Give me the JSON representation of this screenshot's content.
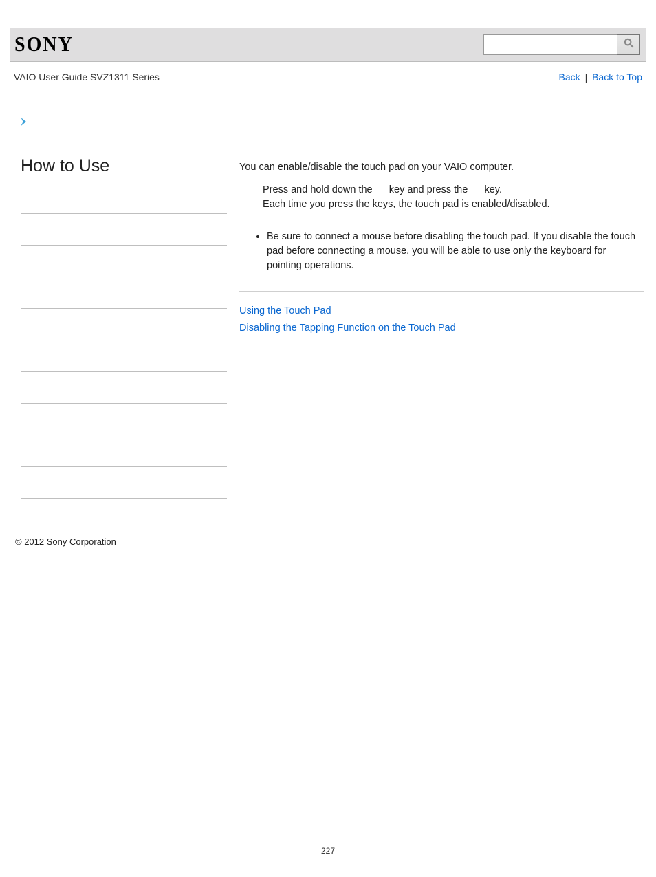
{
  "header": {
    "logo_text": "SONY"
  },
  "search": {
    "value": "",
    "placeholder": ""
  },
  "subheader": {
    "breadcrumb": "VAIO User Guide SVZ1311 Series",
    "back_label": "Back",
    "separator": "|",
    "back_to_top_label": "Back to Top"
  },
  "sidebar": {
    "title": "How to Use",
    "items": [
      "",
      "",
      "",
      "",
      "",
      "",
      "",
      "",
      "",
      ""
    ]
  },
  "main": {
    "intro": "You can enable/disable the touch pad on your VAIO computer.",
    "step_line1_a": "Press and hold down the ",
    "step_line1_b": " key and press the ",
    "step_line1_c": " key.",
    "step_line2": "Each time you press the keys, the touch pad is enabled/disabled.",
    "note_bullet": "Be sure to connect a mouse before disabling the touch pad. If you disable the touch pad before connecting a mouse, you will be able to use only the keyboard for pointing operations.",
    "related_links": [
      "Using the Touch Pad",
      "Disabling the Tapping Function on the Touch Pad"
    ]
  },
  "footer": {
    "copyright": "© 2012 Sony Corporation",
    "page_number": "227"
  }
}
